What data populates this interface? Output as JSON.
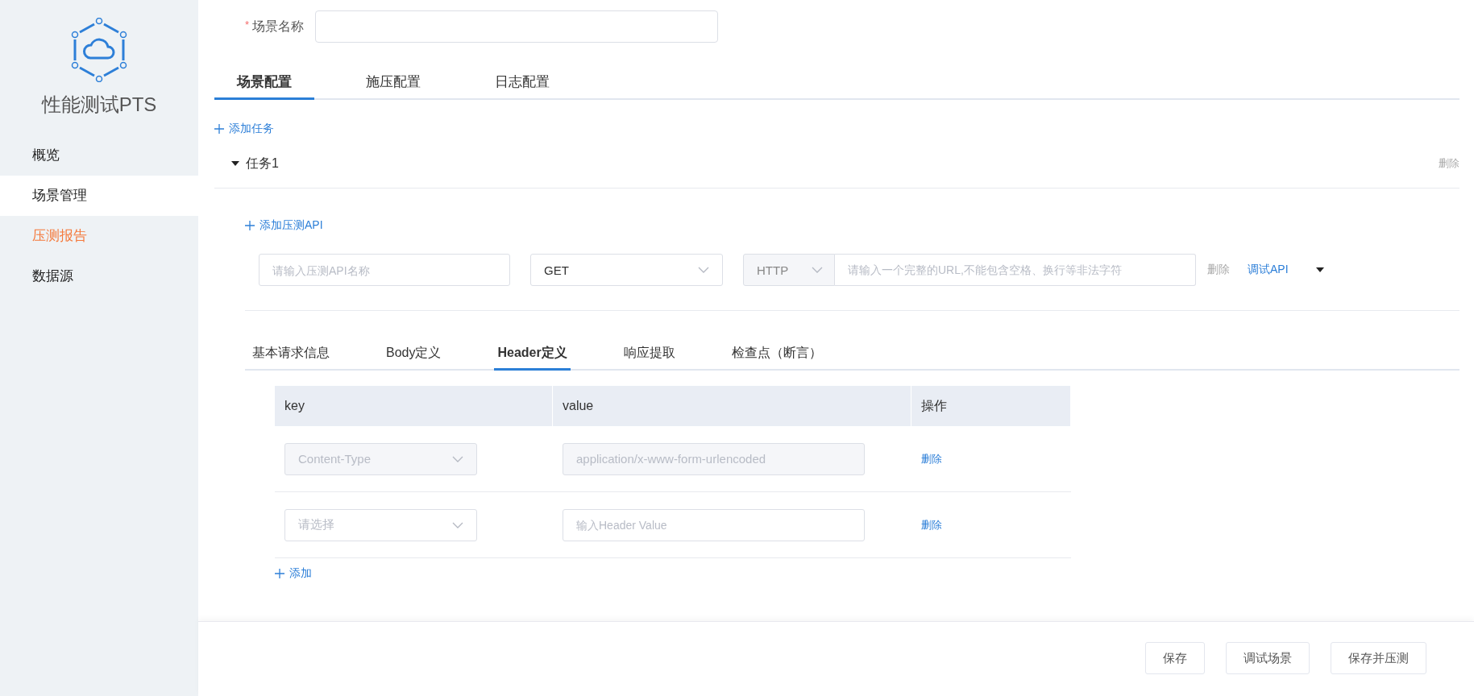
{
  "app": {
    "title": "性能测试PTS"
  },
  "sidebar": {
    "items": [
      {
        "label": "概览",
        "selected": false,
        "hovered": false
      },
      {
        "label": "场景管理",
        "selected": true,
        "hovered": false
      },
      {
        "label": "压测报告",
        "selected": false,
        "hovered": true
      },
      {
        "label": "数据源",
        "selected": false,
        "hovered": false
      }
    ]
  },
  "scene_name": {
    "required_mark": "*",
    "label": "场景名称"
  },
  "config_tabs": [
    {
      "label": "场景配置",
      "selected": true
    },
    {
      "label": "施压配置",
      "selected": false
    },
    {
      "label": "日志配置",
      "selected": false
    }
  ],
  "add_task": "添加任务",
  "tasks": [
    {
      "title": "任务1",
      "expanded": true,
      "delete": "删除",
      "add_api": "添加压测API",
      "apis": [
        {
          "name_placeholder": "请输入压测API名称",
          "method": "GET",
          "protocol": "HTTP",
          "url_placeholder": "请输入一个完整的URL,不能包含空格、换行等非法字符",
          "delete": "删除",
          "debug": "调试API"
        }
      ],
      "request_tabs": [
        {
          "label": "基本请求信息",
          "selected": false
        },
        {
          "label": "Body定义",
          "selected": false
        },
        {
          "label": "Header定义",
          "selected": true
        },
        {
          "label": "响应提取",
          "selected": false
        },
        {
          "label": "检查点（断言）",
          "selected": false
        }
      ],
      "headers": {
        "columns": [
          "key",
          "value",
          "操作"
        ],
        "rows": [
          {
            "disabled": true,
            "key": "Content-Type",
            "value": "application/x-www-form-urlencoded",
            "action": "删除"
          },
          {
            "disabled": false,
            "key_placeholder": "请选择",
            "value_placeholder": "输入Header Value",
            "action": "删除"
          }
        ],
        "add": "添加"
      }
    }
  ],
  "footer": {
    "buttons": [
      "保存",
      "调试场景",
      "保存并压测"
    ]
  }
}
